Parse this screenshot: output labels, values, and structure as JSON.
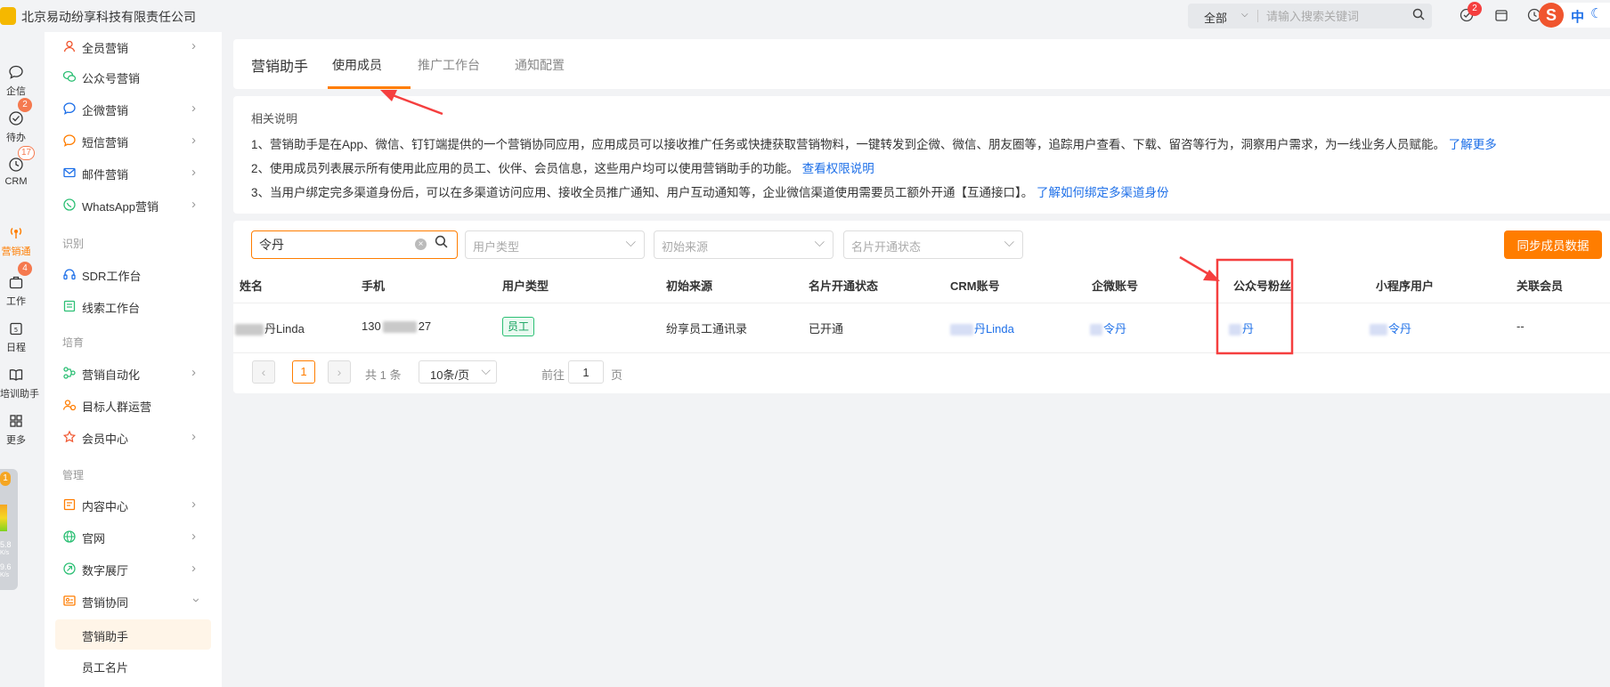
{
  "topbar": {
    "company": "北京易动纷享科技有限责任公司",
    "search_scope": "全部",
    "search_placeholder": "请输入搜索关键词",
    "todo_badge": "2",
    "ime_label": "中"
  },
  "rail": [
    {
      "label": "企信",
      "icon": "chat-icon",
      "badge": ""
    },
    {
      "label": "待办",
      "icon": "check-icon",
      "badge": "2"
    },
    {
      "label": "CRM",
      "icon": "clock-icon",
      "badge": "17"
    },
    {
      "label": "营销通",
      "icon": "broadcast-icon",
      "badge": ""
    },
    {
      "label": "工作",
      "icon": "briefcase-icon",
      "badge": "4"
    },
    {
      "label": "日程",
      "icon": "calendar-icon",
      "badge": ""
    },
    {
      "label": "培训助手",
      "icon": "book-icon",
      "badge": ""
    },
    {
      "label": "更多",
      "icon": "grid-icon",
      "badge": ""
    }
  ],
  "net_widget": {
    "count": "1",
    "up": "5.8",
    "up_unit": "K/s",
    "down": "9.6",
    "down_unit": "K/s"
  },
  "menu": {
    "items_top": [
      {
        "label": "全员营销",
        "has_arrow": true
      },
      {
        "label": "公众号营销",
        "has_arrow": false
      },
      {
        "label": "企微营销",
        "has_arrow": true
      },
      {
        "label": "短信营销",
        "has_arrow": true
      },
      {
        "label": "邮件营销",
        "has_arrow": true
      },
      {
        "label": "WhatsApp营销",
        "has_arrow": true
      }
    ],
    "section_identify": "识别",
    "items_identify": [
      {
        "label": "SDR工作台",
        "has_arrow": false
      },
      {
        "label": "线索工作台",
        "has_arrow": false
      }
    ],
    "section_nurture": "培育",
    "items_nurture": [
      {
        "label": "营销自动化",
        "has_arrow": true
      },
      {
        "label": "目标人群运营",
        "has_arrow": false
      },
      {
        "label": "会员中心",
        "has_arrow": true
      }
    ],
    "section_manage": "管理",
    "items_manage": [
      {
        "label": "内容中心",
        "has_arrow": true
      },
      {
        "label": "官网",
        "has_arrow": true
      },
      {
        "label": "数字展厅",
        "has_arrow": true
      },
      {
        "label": "营销协同",
        "has_arrow": true
      }
    ],
    "sub_items": [
      {
        "label": "营销助手",
        "active": true
      },
      {
        "label": "员工名片",
        "active": false
      }
    ]
  },
  "header": {
    "app_title": "营销助手",
    "tabs": [
      {
        "label": "使用成员",
        "active": true
      },
      {
        "label": "推广工作台",
        "active": false
      },
      {
        "label": "通知配置",
        "active": false
      }
    ]
  },
  "description": {
    "heading": "相关说明",
    "lines": [
      {
        "text": "1、营销助手是在App、微信、钉钉端提供的一个营销协同应用，应用成员可以接收推广任务或快捷获取营销物料，一键转发到企微、微信、朋友圈等，追踪用户查看、下载、留咨等行为，洞察用户需求，为一线业务人员赋能。",
        "link": "了解更多"
      },
      {
        "text": "2、使用成员列表展示所有使用此应用的员工、伙伴、会员信息，这些用户均可以使用营销助手的功能。",
        "link": "查看权限说明"
      },
      {
        "text": "3、当用户绑定完多渠道身份后，可以在多渠道访问应用、接收全员推广通知、用户互动通知等，企业微信渠道使用需要员工额外开通【互通接口】。",
        "link": "了解如何绑定多渠道身份"
      }
    ]
  },
  "filters": {
    "keyword": "令丹",
    "user_type_placeholder": "用户类型",
    "source_placeholder": "初始来源",
    "card_status_placeholder": "名片开通状态",
    "sync_button": "同步成员数据"
  },
  "table": {
    "columns": [
      "姓名",
      "手机",
      "用户类型",
      "初始来源",
      "名片开通状态",
      "CRM账号",
      "企微账号",
      "公众号粉丝",
      "小程序用户",
      "关联会员"
    ],
    "rows": [
      {
        "name": "丹Linda",
        "phone_prefix": "130",
        "phone_suffix": "27",
        "user_type": "员工",
        "source": "纷享员工通讯录",
        "card_status": "已开通",
        "crm_account": "丹Linda",
        "wecom_account": "令丹",
        "mp_fan": "丹",
        "miniapp_user": "令丹",
        "member": "--"
      }
    ]
  },
  "pagination": {
    "prev": "‹",
    "current": "1",
    "next": "›",
    "total_text": "共 1 条",
    "page_size": "10条/页",
    "goto_prefix": "前往",
    "goto_value": "1",
    "goto_suffix": "页"
  },
  "colors": {
    "accent": "#ff7d00",
    "link": "#1d6fe8",
    "annotation": "#f53f3f",
    "tag_green": "#0fa05a"
  }
}
